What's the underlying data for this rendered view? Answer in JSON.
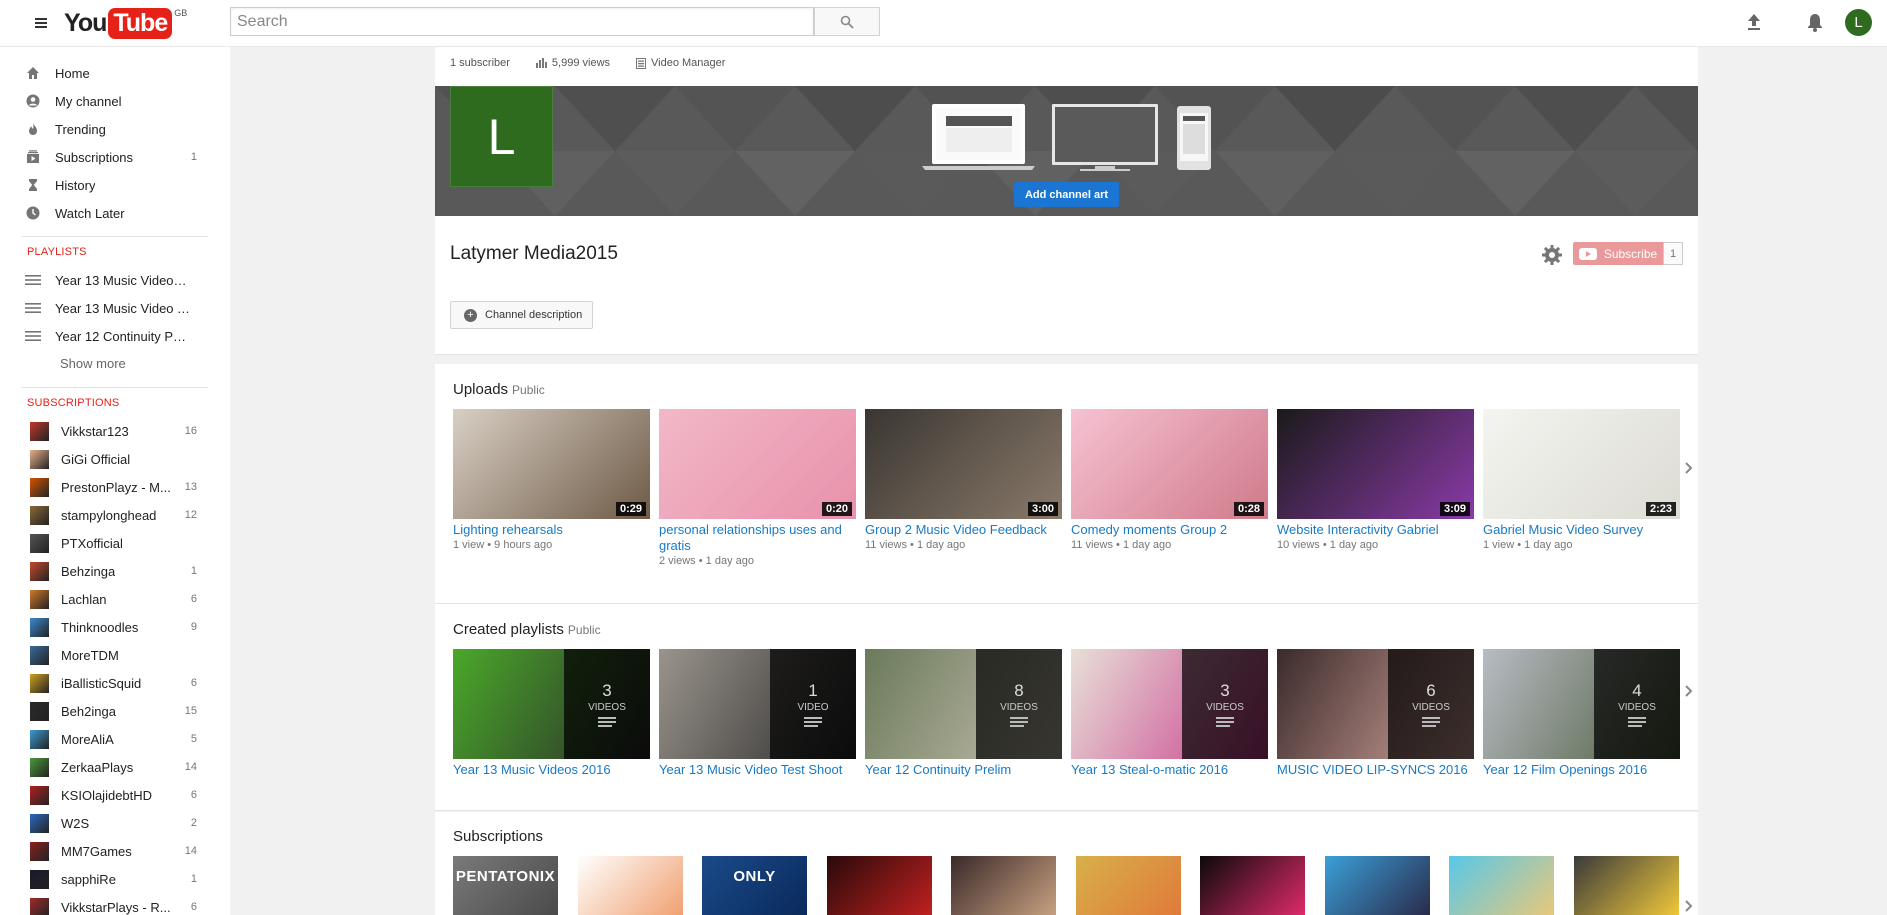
{
  "masthead": {
    "logo_you": "You",
    "logo_tube": "Tube",
    "region": "GB",
    "search_placeholder": "Search",
    "avatar_letter": "L"
  },
  "guide": {
    "main": [
      {
        "label": "Home",
        "icon": "home-icon"
      },
      {
        "label": "My channel",
        "icon": "person-icon"
      },
      {
        "label": "Trending",
        "icon": "flame-icon"
      },
      {
        "label": "Subscriptions",
        "icon": "subscriptions-icon",
        "count": "1"
      },
      {
        "label": "History",
        "icon": "hourglass-icon"
      },
      {
        "label": "Watch Later",
        "icon": "clock-icon"
      }
    ],
    "playlists_header": "PLAYLISTS",
    "playlists": [
      {
        "label": "Year 13 Music Videos ..."
      },
      {
        "label": "Year 13 Music Video T..."
      },
      {
        "label": "Year 12 Continuity Pre..."
      }
    ],
    "show_more": "Show more",
    "subscriptions_header": "SUBSCRIPTIONS",
    "subscriptions": [
      {
        "label": "Vikkstar123",
        "count": "16",
        "color": "#c0392b"
      },
      {
        "label": "GiGi Official",
        "count": "",
        "color": "#e8b08a"
      },
      {
        "label": "PrestonPlayz - M...",
        "count": "13",
        "color": "#d35400"
      },
      {
        "label": "stampylonghead",
        "count": "12",
        "color": "#8a6a3a"
      },
      {
        "label": "PTXofficial",
        "count": "",
        "color": "#555555"
      },
      {
        "label": "Behzinga",
        "count": "1",
        "color": "#c44a2a"
      },
      {
        "label": "Lachlan",
        "count": "6",
        "color": "#d07a2a"
      },
      {
        "label": "Thinknoodles",
        "count": "9",
        "color": "#3a8ad0"
      },
      {
        "label": "MoreTDM",
        "count": "",
        "color": "#3a6a9a"
      },
      {
        "label": "iBallisticSquid",
        "count": "6",
        "color": "#d0a020"
      },
      {
        "label": "Beh2inga",
        "count": "15",
        "color": "#2a2a2a"
      },
      {
        "label": "MoreAliA",
        "count": "5",
        "color": "#3a9ad0"
      },
      {
        "label": "ZerkaaPlays",
        "count": "14",
        "color": "#4a9a3a"
      },
      {
        "label": "KSIOlajidebtHD",
        "count": "6",
        "color": "#b02020"
      },
      {
        "label": "W2S",
        "count": "2",
        "color": "#2a6ac0"
      },
      {
        "label": "MM7Games",
        "count": "14",
        "color": "#8a2020"
      },
      {
        "label": "sapphiRe",
        "count": "1",
        "color": "#1a1a2a"
      },
      {
        "label": "VikkstarPlays - R...",
        "count": "6",
        "color": "#a02a2a"
      }
    ]
  },
  "header_stats": {
    "subscribers": "1 subscriber",
    "views": "5,999 views",
    "video_manager": "Video Manager"
  },
  "channel": {
    "avatar_letter": "L",
    "add_art": "Add channel art",
    "title": "Latymer Media2015",
    "subscribe": "Subscribe",
    "subscriber_count": "1",
    "description_button": "Channel description"
  },
  "uploads": {
    "title": "Uploads",
    "visibility": "Public",
    "videos": [
      {
        "title": "Lighting rehearsals",
        "duration": "0:29",
        "views": "1 view",
        "age": "9 hours ago",
        "c1": "#d8cfc4",
        "c2": "#6e5a46"
      },
      {
        "title": "personal relationships uses and gratis",
        "duration": "0:20",
        "views": "2 views",
        "age": "1 day ago",
        "c1": "#f2b8c8",
        "c2": "#e891ab"
      },
      {
        "title": "Group 2 Music Video Feedback",
        "duration": "3:00",
        "views": "11 views",
        "age": "1 day ago",
        "c1": "#3a3632",
        "c2": "#8a7a6a"
      },
      {
        "title": "Comedy moments Group 2",
        "duration": "0:28",
        "views": "11 views",
        "age": "1 day ago",
        "c1": "#f6c2d2",
        "c2": "#d07a8a"
      },
      {
        "title": "Website Interactivity Gabriel",
        "duration": "3:09",
        "views": "10 views",
        "age": "1 day ago",
        "c1": "#1a1a1a",
        "c2": "#8a3aa8"
      },
      {
        "title": "Gabriel Music Video Survey",
        "duration": "2:23",
        "views": "1 view",
        "age": "1 day ago",
        "c1": "#f4f4f0",
        "c2": "#dcdcd4"
      }
    ]
  },
  "playlists_section": {
    "title": "Created playlists",
    "visibility": "Public",
    "items": [
      {
        "title": "Year 13 Music Videos 2016",
        "count": "3",
        "unit": "VIDEOS",
        "c1": "#4aa82a",
        "c2": "#2a2a2a"
      },
      {
        "title": "Year 13 Music Video Test Shoot",
        "count": "1",
        "unit": "VIDEO",
        "c1": "#9a948c",
        "c2": "#2a2a2a"
      },
      {
        "title": "Year 12 Continuity Prelim",
        "count": "8",
        "unit": "VIDEOS",
        "c1": "#6a7a5a",
        "c2": "#c8c0b0"
      },
      {
        "title": "Year 13 Steal-o-matic 2016",
        "count": "3",
        "unit": "VIDEOS",
        "c1": "#e8e0d8",
        "c2": "#c83a8a"
      },
      {
        "title": "MUSIC VIDEO LIP-SYNCS 2016",
        "count": "6",
        "unit": "VIDEOS",
        "c1": "#3a2a2a",
        "c2": "#d8a8a0"
      },
      {
        "title": "Year 12 Film Openings 2016",
        "count": "4",
        "unit": "VIDEOS",
        "c1": "#b8bcc4",
        "c2": "#4a5a3a"
      }
    ]
  },
  "subscriptions_section": {
    "title": "Subscriptions",
    "channels": [
      {
        "label": "PENTATONIX",
        "c1": "#7a7a7a",
        "c2": "#4a4a4a"
      },
      {
        "label": "",
        "c1": "#ffffff",
        "c2": "#f0a070"
      },
      {
        "label": "ONLY",
        "c1": "#1a4a8a",
        "c2": "#0a2a5a"
      },
      {
        "label": "",
        "c1": "#2a0a0a",
        "c2": "#c02020"
      },
      {
        "label": "",
        "c1": "#3a2a2a",
        "c2": "#c8a080"
      },
      {
        "label": "",
        "c1": "#d8b04a",
        "c2": "#e07a3a"
      },
      {
        "label": "",
        "c1": "#0a0a0a",
        "c2": "#e02a6a"
      },
      {
        "label": "",
        "c1": "#3aa0d8",
        "c2": "#2a2a4a"
      },
      {
        "label": "",
        "c1": "#58c8e8",
        "c2": "#e8c87a"
      },
      {
        "label": "",
        "c1": "#3a3a3a",
        "c2": "#f0c83a"
      }
    ]
  }
}
